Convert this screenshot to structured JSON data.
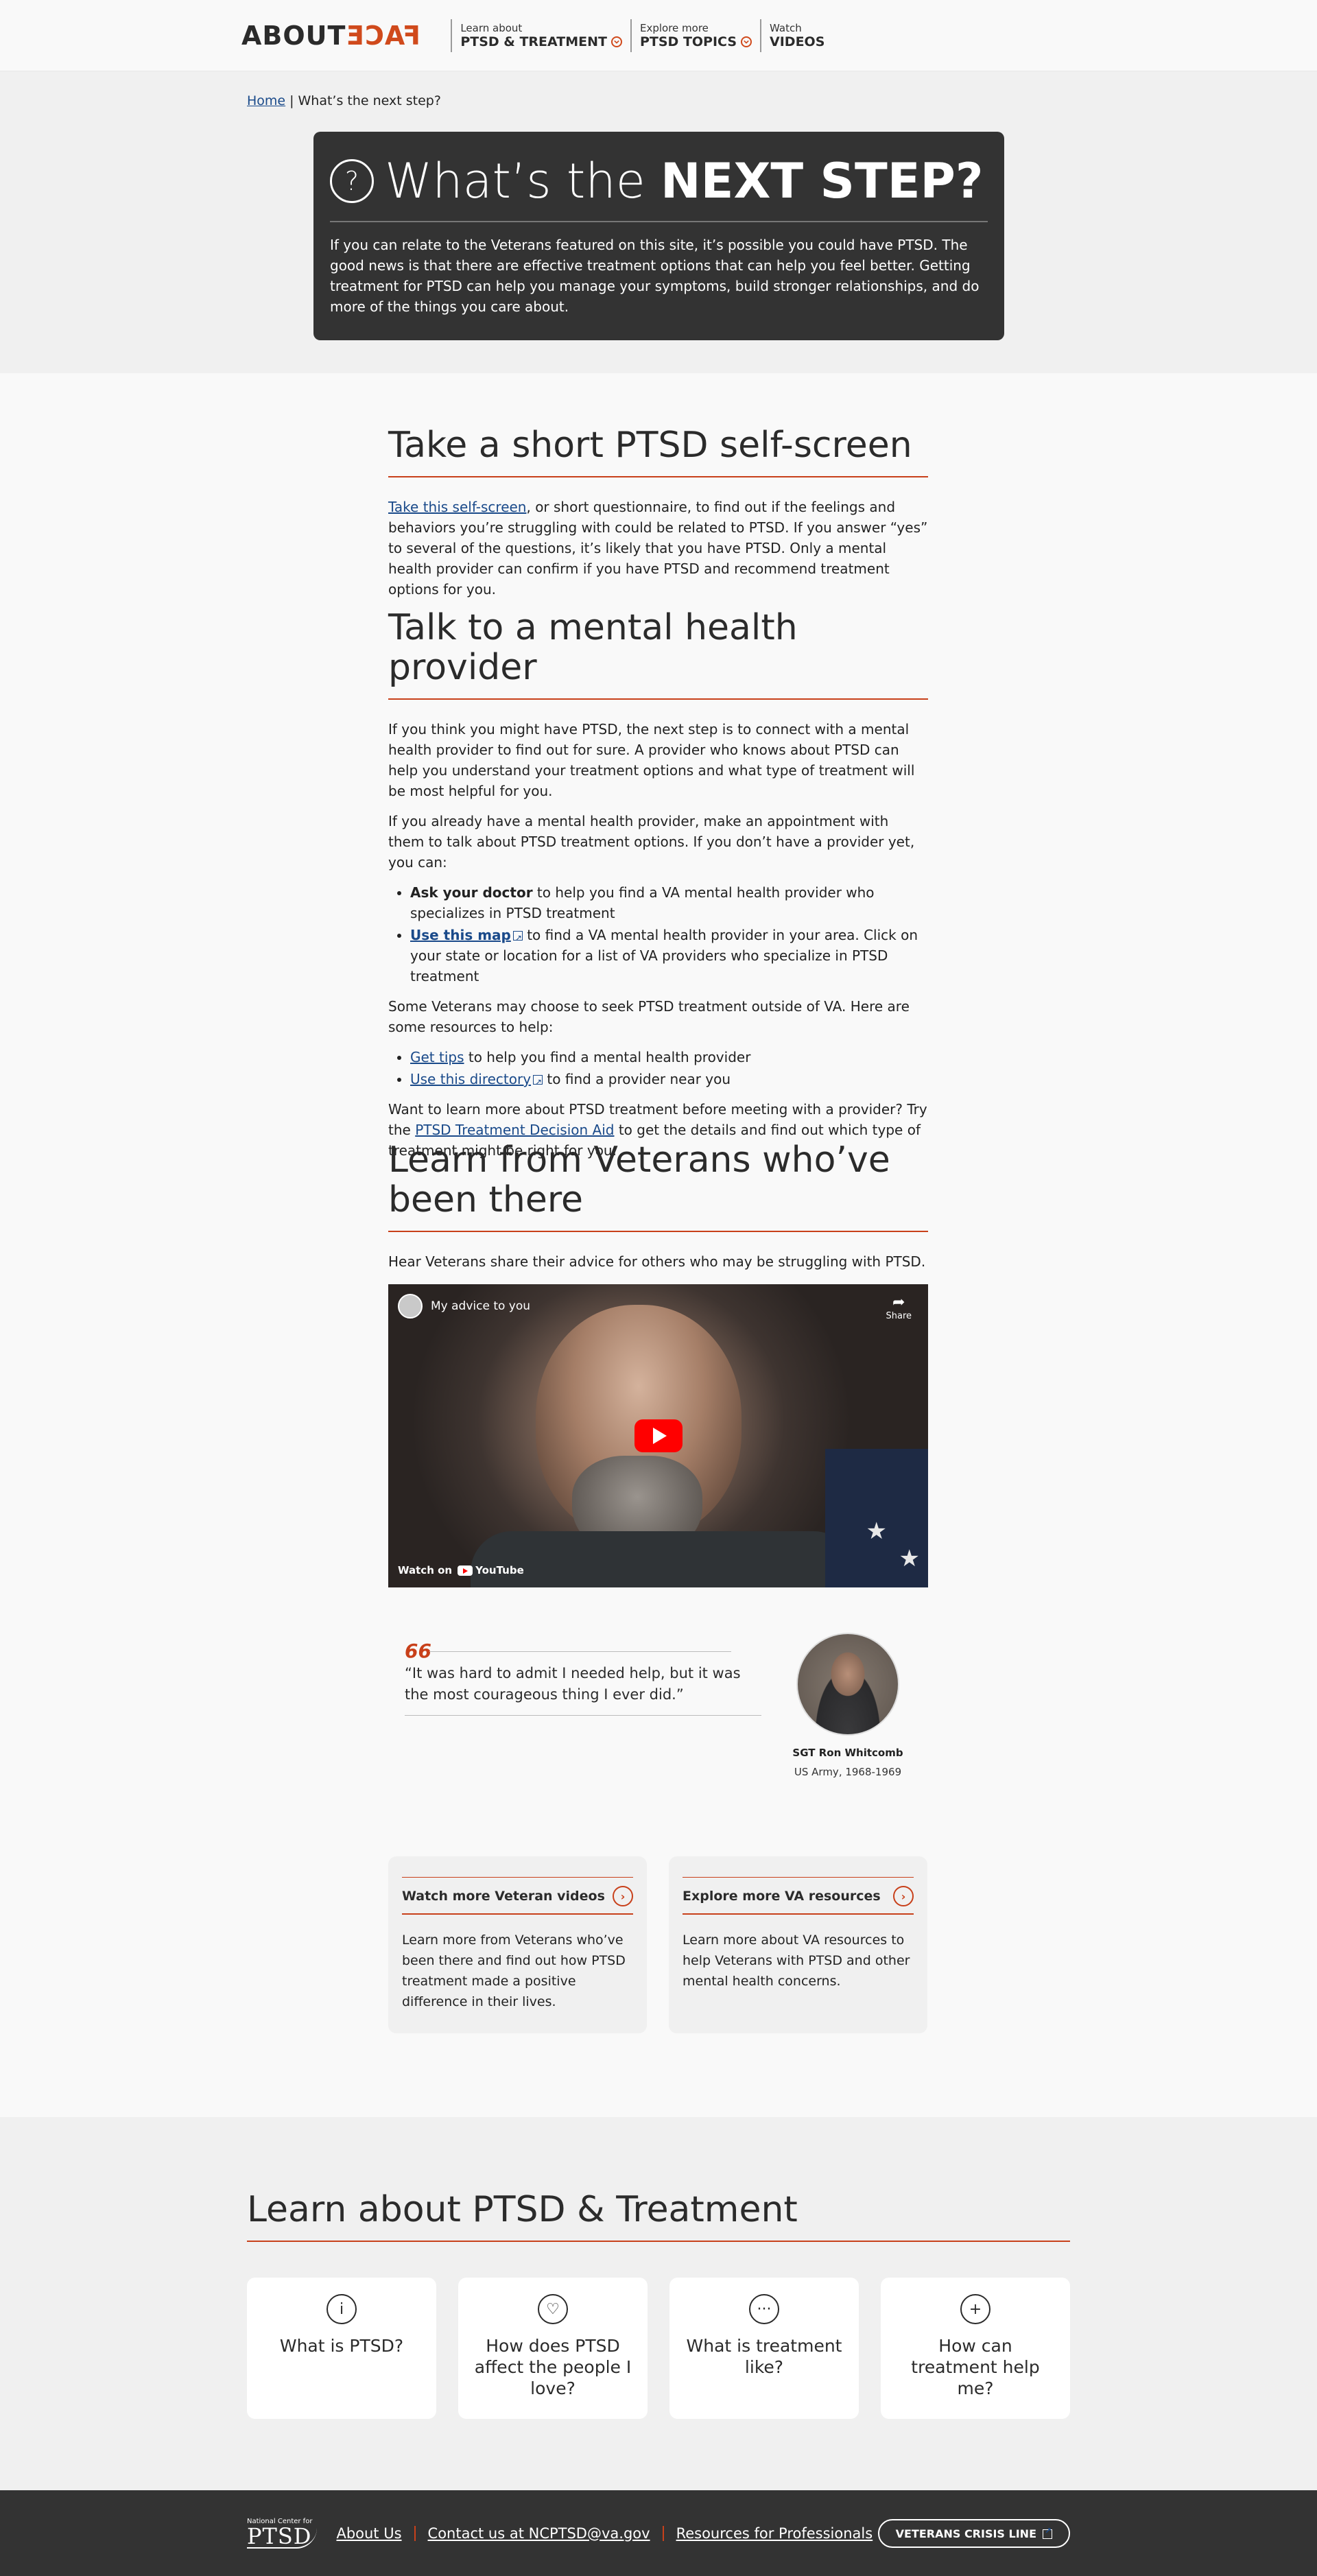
{
  "header": {
    "logo_about": "ABOUT",
    "logo_face": "FACE",
    "nav": [
      {
        "small": "Learn about",
        "big": "PTSD & TREATMENT"
      },
      {
        "small": "Explore more",
        "big": "PTSD TOPICS"
      },
      {
        "small": "Watch",
        "big": "VIDEOS"
      }
    ]
  },
  "breadcrumb": {
    "home": "Home",
    "sep": "|",
    "current": "What’s the next step?"
  },
  "hero": {
    "icon": "?",
    "title_light": "What’s the",
    "title_bold": "NEXT STEP?",
    "body": "If you can relate to the Veterans featured on this site, it’s possible you could have PTSD. The good news is that there are effective treatment options that can help you feel better. Getting treatment for PTSD can help you manage your symptoms, build stronger relationships, and do more of the things you care about."
  },
  "sections": {
    "selfscreen": {
      "title": "Take a short PTSD self-screen",
      "link": "Take this self-screen",
      "text": ", or short questionnaire, to find out if the feelings and behaviors you’re struggling with could be related to PTSD. If you answer “yes” to several of the questions, it’s likely that you have PTSD. Only a mental health provider can confirm if you have PTSD and recommend treatment options for you."
    },
    "provider": {
      "title": "Talk to a mental health provider",
      "p1": "If you think you might have PTSD, the next step is to connect with a mental health provider to find out for sure. A provider who knows about PTSD can help you understand your treatment options and what type of treatment will be most helpful for you.",
      "p2": "If you already have a mental health provider, make an appointment with them to talk about PTSD treatment options. If you don’t have a provider yet, you can:",
      "b1_bold": "Ask your doctor",
      "b1_text": " to help you find a VA mental health provider who specializes in PTSD treatment",
      "b2_link": "Use this map",
      "b2_text": " to find a VA mental health provider in your area. Click on your state or location for a list of VA providers who specialize in PTSD treatment",
      "p3": "Some Veterans may choose to seek PTSD treatment outside of VA. Here are some resources to help:",
      "b3_link": "Get tips",
      "b3_text": " to help you find a mental health provider",
      "b4_link": "Use this directory",
      "b4_text": " to find a provider near you",
      "p4_a": "Want to learn more about PTSD treatment before meeting with a provider? Try the ",
      "p4_link": "PTSD Treatment Decision Aid",
      "p4_b": " to get the details and find out which type of treatment might be right for you."
    },
    "veterans": {
      "title": "Learn from Veterans who’ve been there",
      "intro": "Hear Veterans share their advice for others who may be struggling with PTSD."
    }
  },
  "video": {
    "title": "My advice to you",
    "share": "Share",
    "watch_on": "Watch on",
    "youtube": "YouTube"
  },
  "quote": {
    "mark": "66",
    "text": "“It was hard to admit I needed help, but it was the most courageous thing I ever did.”",
    "name": "SGT Ron Whitcomb",
    "role": "US Army, 1968-1969"
  },
  "cards": [
    {
      "title": "Watch more Veteran videos",
      "body": "Learn more from Veterans who’ve been there and find out how PTSD treatment made a positive difference in their lives."
    },
    {
      "title": "Explore more VA resources",
      "body": "Learn more about VA resources to help Veterans with PTSD and other mental health concerns."
    }
  ],
  "learn": {
    "title": "Learn about PTSD & Treatment",
    "tiles": [
      {
        "icon": "info-icon",
        "glyph": "i",
        "label": "What is PTSD?"
      },
      {
        "icon": "heart-icon",
        "glyph": "♡",
        "label": "How does PTSD affect the people I love?"
      },
      {
        "icon": "chat-icon",
        "glyph": "···",
        "label": "What is treatment like?"
      },
      {
        "icon": "plus-icon",
        "glyph": "+",
        "label": "How can treatment help me?"
      }
    ]
  },
  "footer": {
    "logo_small": "National Center for",
    "logo_big": "PTSD",
    "links": [
      "About Us",
      "Contact us at NCPTSD@va.gov",
      "Resources for Professionals"
    ],
    "crisis": "VETERANS CRISIS LINE"
  },
  "colors": {
    "accent": "#c8401a",
    "dark": "#333333",
    "link": "#1a4a8a"
  }
}
